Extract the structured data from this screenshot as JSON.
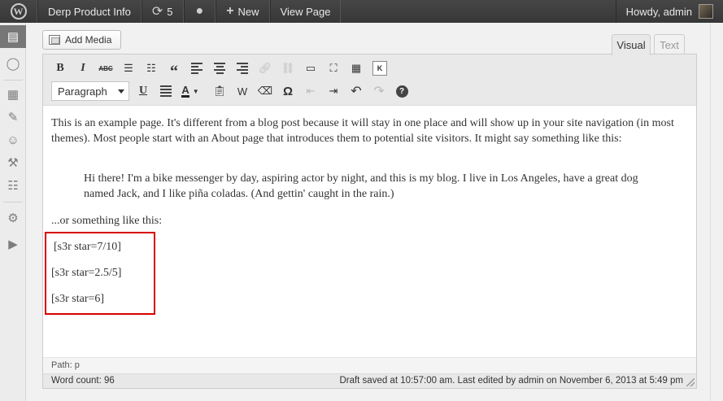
{
  "adminbar": {
    "site_name": "Derp Product Info",
    "updates_count": "5",
    "new_label": "New",
    "view_page_label": "View Page",
    "greeting": "Howdy, admin"
  },
  "media": {
    "add_media_label": "Add Media"
  },
  "tabs": {
    "visual": "Visual",
    "text": "Text"
  },
  "toolbar": {
    "format_value": "Paragraph"
  },
  "content": {
    "p1": "This is an example page. It's different from a blog post because it will stay in one place and will show up in your site navigation (in most themes). Most people start with an About page that introduces them to potential site visitors. It might say something like this:",
    "quote": "Hi there! I'm a bike messenger by day, aspiring actor by night, and this is my blog. I live in Los Angeles, have a great dog named Jack, and I like piña coladas. (And gettin' caught in the rain.)",
    "p2": "...or something like this:",
    "shortcodes": [
      "[s3r star=7/10]",
      "[s3r star=2.5/5]",
      "[s3r star=6]"
    ]
  },
  "status": {
    "path": "Path: p",
    "word_count": "Word count: 96",
    "last_saved": "Draft saved at 10:57:00 am. Last edited by admin on November 6, 2013 at 5:49 pm"
  },
  "icons": [
    "wordpress-logo-icon",
    "updates-icon",
    "comments-icon",
    "plus-icon",
    "pages-icon",
    "comment-bubble-icon",
    "appearance-icon",
    "plugins-icon",
    "users-icon",
    "tools-icon",
    "settings-icon",
    "collapse-icon"
  ],
  "colors": {
    "adminbar": "#3a3a3a",
    "highlight_border": "#d80000",
    "current_menu": "#777777"
  }
}
